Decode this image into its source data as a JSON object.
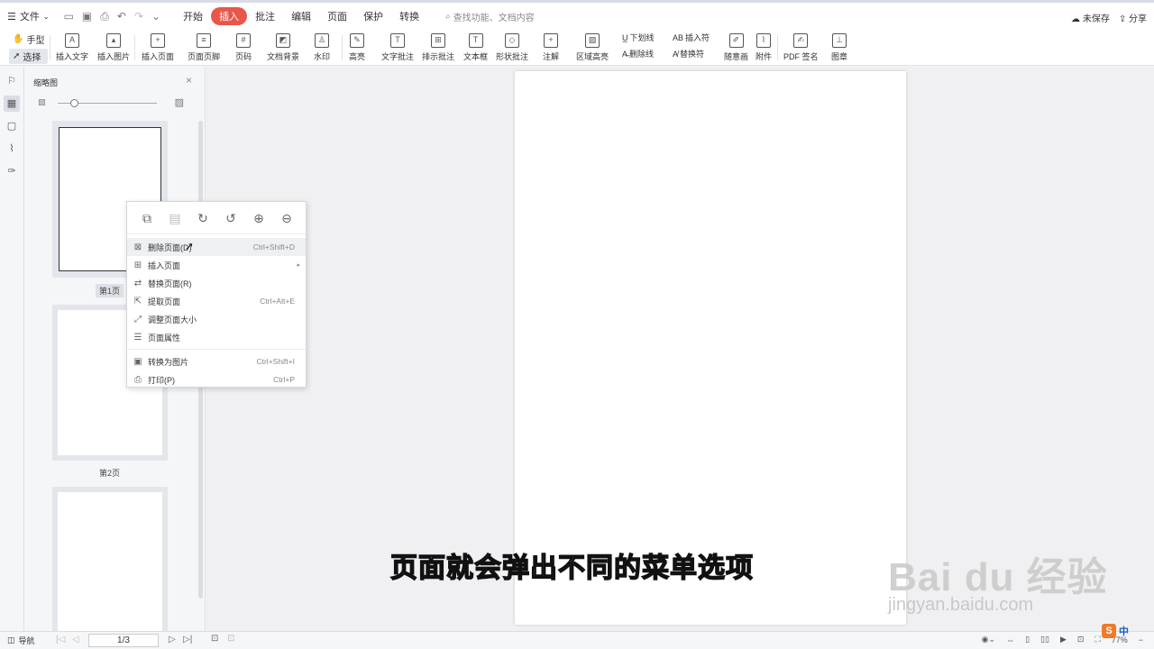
{
  "topbar": {
    "file_label": "文件",
    "tabs": [
      "开始",
      "插入",
      "批注",
      "编辑",
      "页面",
      "保护",
      "转换"
    ],
    "active_tab": "插入",
    "search_placeholder": "查找功能、文档内容",
    "unsaved_label": "未保存",
    "share_label": "分享"
  },
  "ribbon": {
    "hand_tool": "手型",
    "select_tool": "选择",
    "buttons": [
      "插入文字",
      "插入图片",
      "插入页面",
      "页面页脚",
      "页码",
      "文档背景",
      "水印",
      "高亮",
      "文字批注",
      "排示批注",
      "文本框",
      "形状批注",
      "注解",
      "区域高亮",
      "随意画",
      "附件",
      "PDF 签名",
      "图章"
    ],
    "underline_label": "下划线",
    "strike_label": "删除线",
    "insert_char_label": "插入符",
    "replace_char_label": "替换符"
  },
  "thumbnails": {
    "header": "缩略图",
    "pages": [
      "第1页",
      "第2页"
    ]
  },
  "context_menu": {
    "items": [
      {
        "label": "删除页面(D)",
        "shortcut": "Ctrl+Shift+D"
      },
      {
        "label": "插入页面",
        "shortcut": ""
      },
      {
        "label": "替换页面(R)",
        "shortcut": ""
      },
      {
        "label": "提取页面",
        "shortcut": "Ctrl+Alt+E"
      },
      {
        "label": "调整页面大小",
        "shortcut": ""
      },
      {
        "label": "页面属性",
        "shortcut": ""
      },
      {
        "label": "转换为图片",
        "shortcut": "Ctrl+Shift+I"
      },
      {
        "label": "打印(P)",
        "shortcut": "Ctrl+P"
      }
    ]
  },
  "subtitle": "页面就会弹出不同的菜单选项",
  "watermark": {
    "brand": "Bai du 经验",
    "url": "jingyan.baidu.com"
  },
  "status": {
    "nav_label": "导航",
    "page_indicator": "1/3",
    "zoom": "77%"
  },
  "ime": {
    "lang": "中"
  }
}
